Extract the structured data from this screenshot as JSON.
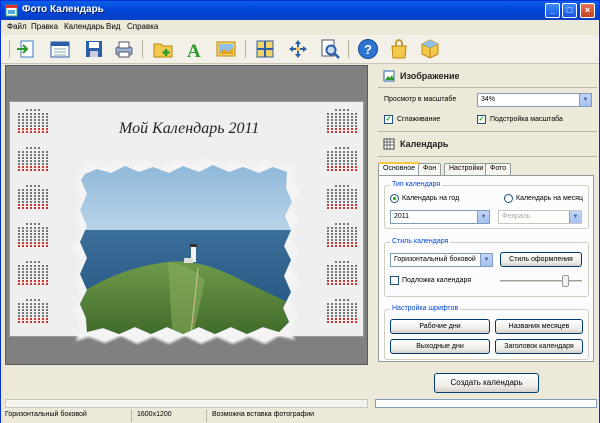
{
  "window": {
    "title": "Фото Календарь"
  },
  "menu": [
    "Файл",
    "Правка",
    "Календарь",
    "Вид",
    "Справка"
  ],
  "toolbar": {
    "icons": [
      "import-icon",
      "calendar-icon",
      "save-icon",
      "print-icon",
      "add-photo-icon",
      "text-icon",
      "image-icon",
      "layout-icon",
      "move-icon",
      "search-icon",
      "help-icon",
      "bag-icon",
      "box-icon"
    ]
  },
  "preview": {
    "title": "Мой Календарь 2011"
  },
  "image_section": {
    "header": "Изображение",
    "zoom_label": "Просмотр в масштабе",
    "zoom_value": "34%",
    "smoothing_label": "Сглаживание",
    "smoothing_checked": true,
    "fit_label": "Подстройка масштаба",
    "fit_checked": true
  },
  "calendar_section": {
    "header": "Календарь",
    "tabs": [
      "Основное",
      "Фон",
      "Настройки",
      "Фото"
    ],
    "active_tab": 0,
    "type_group": {
      "title": "Тип календаря",
      "year_label": "Календарь на год",
      "month_label": "Календарь на месяц",
      "year_selected": true,
      "year_value": "2011",
      "month_value": "Февраль"
    },
    "style_group": {
      "title": "Стиль календаря",
      "style_value": "Горизонтальный боковой",
      "style_button": "Стиль оформления",
      "backing_label": "Подложка календаря",
      "backing_checked": false
    },
    "fonts_group": {
      "title": "Настройка шрифтов",
      "work_days": "Рабочие дни",
      "month_names": "Названия месяцев",
      "weekends": "Выходные дни",
      "calendar_title": "Заголовок календаря"
    },
    "create_button": "Создать календарь"
  },
  "status": {
    "style": "Горизонтальный боковой",
    "size": "1600x1200",
    "hint": "Возможна вставка фотографии"
  },
  "colors": {
    "titlebar": "#0a5fe8",
    "accent_blue": "#0046d5",
    "check_green": "#21a121"
  }
}
